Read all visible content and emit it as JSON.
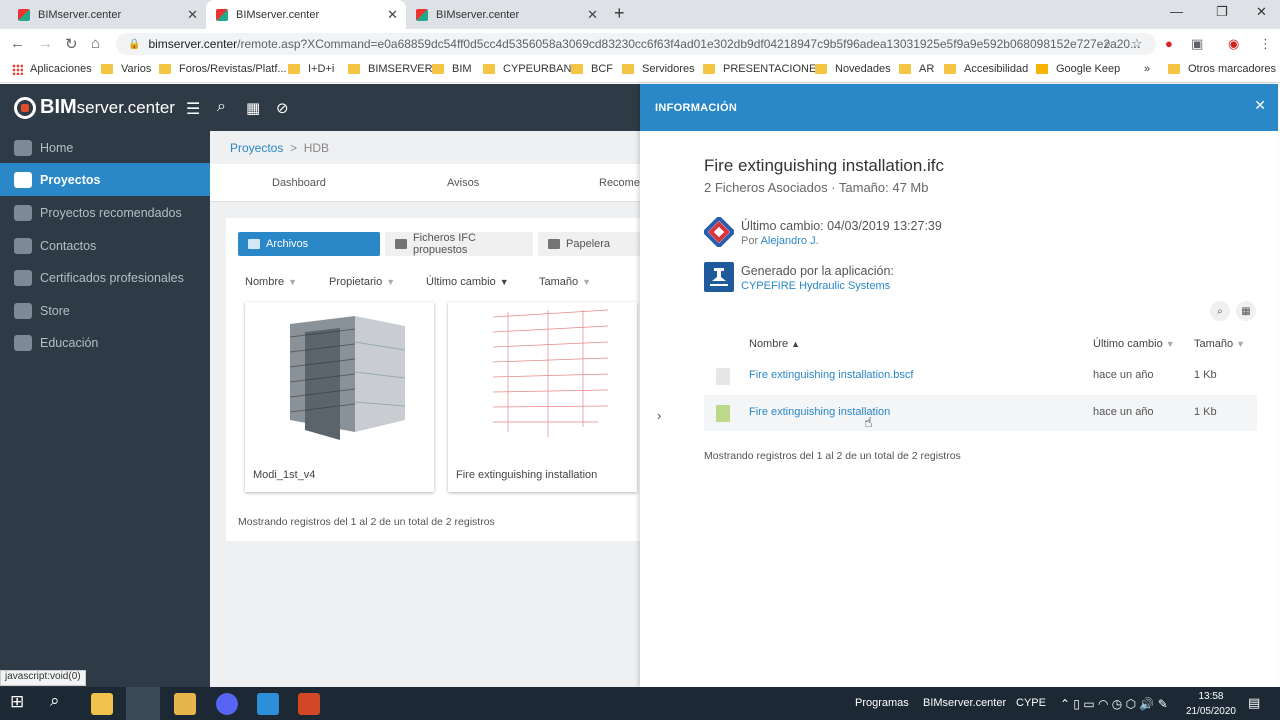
{
  "browser": {
    "tabs": [
      {
        "title": "BIMserver.center"
      },
      {
        "title": "BIMserver.center"
      },
      {
        "title": "BIMserver.center"
      }
    ],
    "url_host": "bimserver.center",
    "url_path": "/remote.asp?XCommand=e0a68859dc54ff0d5cc4d5356058a3069cd83230cc6f63f4ad01e302db9df04218947c9b5f96adea13031925e5f9a9e592b068098152e727e2a20...",
    "bookmarks": [
      "Aplicaciones",
      "Varios",
      "Foros/Revistas/Platf...",
      "I+D+i",
      "BIMSERVER",
      "BIM",
      "CYPEURBAN",
      "BCF",
      "Servidores",
      "PRESENTACIONES",
      "Novedades",
      "AR",
      "Accesibilidad",
      "Google Keep",
      "Otros marcadores"
    ],
    "status_text": "javascript:void(0)"
  },
  "app": {
    "logo_bold": "BIM",
    "logo_light": "server.center",
    "nav": [
      "Home",
      "Proyectos",
      "Proyectos recomendados",
      "Contactos",
      "Certificados profesionales",
      "Store",
      "Educación"
    ],
    "breadcrumb": {
      "root": "Proyectos",
      "sep": ">",
      "current": "HDB"
    },
    "subtabs": [
      "Dashboard",
      "Avisos",
      "Recomer"
    ],
    "buttons": {
      "archivos": "Archivos",
      "ifc": "Ficheros IFC propuestos",
      "papelera": "Papelera"
    },
    "columns": [
      "Nombre",
      "Propietario",
      "Último cambio",
      "Tamaño"
    ],
    "cards": [
      {
        "name": "Modi_1st_v4"
      },
      {
        "name": "Fire extinguishing installation"
      }
    ],
    "footer": "Mostrando registros del 1 al 2 de un total de 2 registros"
  },
  "info": {
    "header": "INFORMACIÓN",
    "title": "Fire extinguishing installation.ifc",
    "subtitle": "2 Ficheros Asociados · Tamaño: 47 Mb",
    "last_change_label": "Último cambio: 04/03/2019 13:27:39",
    "by_label": "Por",
    "by_user": "Alejandro J.",
    "generated_label": "Generado por la aplicación:",
    "generated_app": "CYPEFIRE Hydraulic Systems",
    "table_headers": [
      "Nombre",
      "Último cambio",
      "Tamaño"
    ],
    "rows": [
      {
        "name": "Fire extinguishing installation.bscf",
        "date": "hace un año",
        "size": "1 Kb"
      },
      {
        "name": "Fire extinguishing installation",
        "date": "hace un año",
        "size": "1 Kb"
      }
    ],
    "footer": "Mostrando registros del 1 al 2 de un total de 2 registros"
  },
  "taskbar": {
    "labels": [
      "Programas",
      "BIMserver.center",
      "CYPE"
    ],
    "time": "13:58",
    "date": "21/05/2020"
  }
}
